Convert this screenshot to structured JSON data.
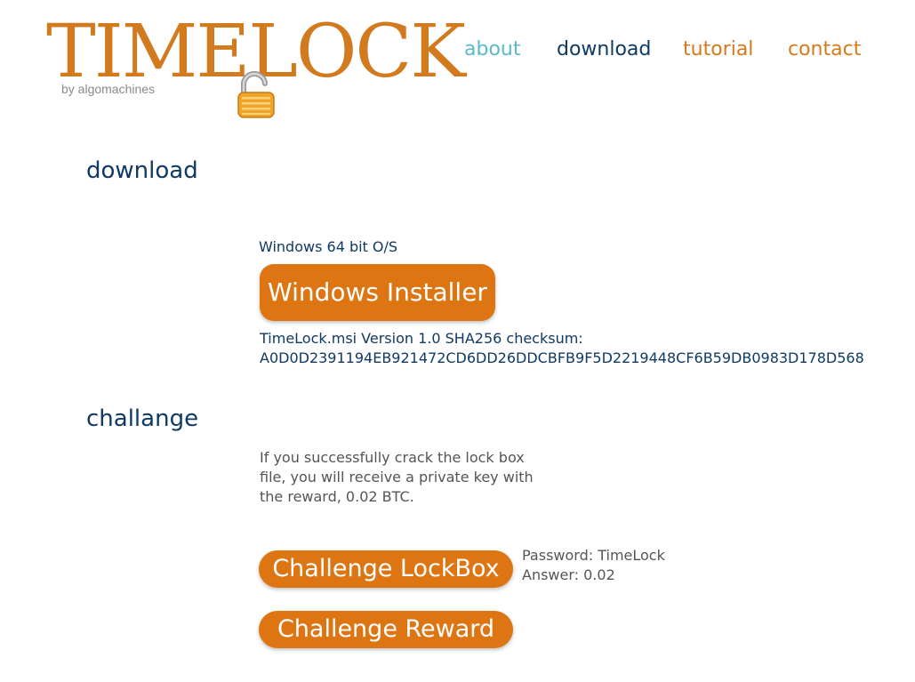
{
  "logo": {
    "title": "TIMELOCK",
    "subtitle": "by algomachines",
    "icon": "padlock-icon"
  },
  "nav": {
    "about": "about",
    "download": "download",
    "tutorial": "tutorial",
    "contact": "contact"
  },
  "download": {
    "heading": "download",
    "os_label": "Windows 64 bit O/S",
    "installer_button": "Windows Installer",
    "checksum_line1": "TimeLock.msi Version 1.0 SHA256 checksum:",
    "checksum_line2": "A0D0D2391194EB921472CD6DD26DDCBFB9F5D2219448CF6B59DB0983D178D568"
  },
  "challenge": {
    "heading": "challange",
    "text": "If you successfully crack the lock box file, you will receive a private key with the reward, 0.02 BTC.",
    "lockbox_button": "Challenge LockBox",
    "reward_button": "Challenge Reward",
    "password_line": "Password: TimeLock",
    "answer_line": "Answer: 0.02"
  },
  "colors": {
    "brand_orange": "#dd7512",
    "navy": "#0f3a63",
    "about_teal": "#5bb9cc"
  }
}
